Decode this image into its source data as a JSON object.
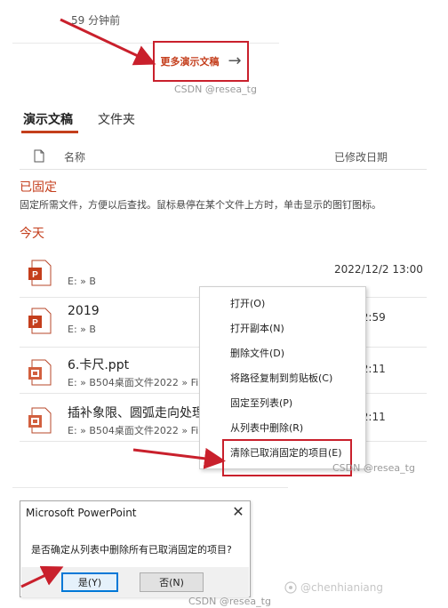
{
  "top": {
    "time_ago": "59 分钟前",
    "more_documents_label": "更多演示文稿",
    "more_documents_arrow": "→",
    "watermark": "CSDN @resea_tg"
  },
  "tabs": [
    {
      "label": "演示文稿",
      "active": true
    },
    {
      "label": "文件夹",
      "active": false
    }
  ],
  "list_header": {
    "name": "名称",
    "modified": "已修改日期"
  },
  "pinned": {
    "title": "已固定",
    "description": "固定所需文件，方便以后查找。鼠标悬停在某个文件上方时，单击显示的图钉图标。"
  },
  "today": {
    "title": "今天"
  },
  "files": [
    {
      "name": "",
      "path": "E: » B",
      "date": "2022/12/2 13:00"
    },
    {
      "name": "2019",
      "path": "E: » B",
      "date": "2/2 12:59"
    },
    {
      "name": "6.卡尺.ppt",
      "path": "E: » B504桌面文件2022 » Fil",
      "date": "2/2 12:11"
    },
    {
      "name": "插补象限、圆弧走向处理",
      "path": "E: » B504桌面文件2022 » Fil",
      "date": "2/2 12:11"
    }
  ],
  "context_menu": {
    "items": [
      "打开(O)",
      "打开副本(N)",
      "删除文件(D)",
      "将路径复制到剪贴板(C)",
      "固定至列表(P)",
      "从列表中删除(R)",
      "清除已取消固定的项目(E)"
    ],
    "watermark": "CSDN @resea_tg"
  },
  "dialog": {
    "title": "Microsoft PowerPoint",
    "close": "✕",
    "message": "是否确定从列表中删除所有已取消固定的项目?",
    "yes_label": "是(Y)",
    "no_label": "否(N)"
  },
  "bottom": {
    "watermark": "CSDN @resea_tg",
    "watermark_brand": "@chenhianiang"
  },
  "colors": {
    "accent": "#c43e1c",
    "annotation_red": "#c9202c",
    "focus_blue": "#0078d7"
  }
}
